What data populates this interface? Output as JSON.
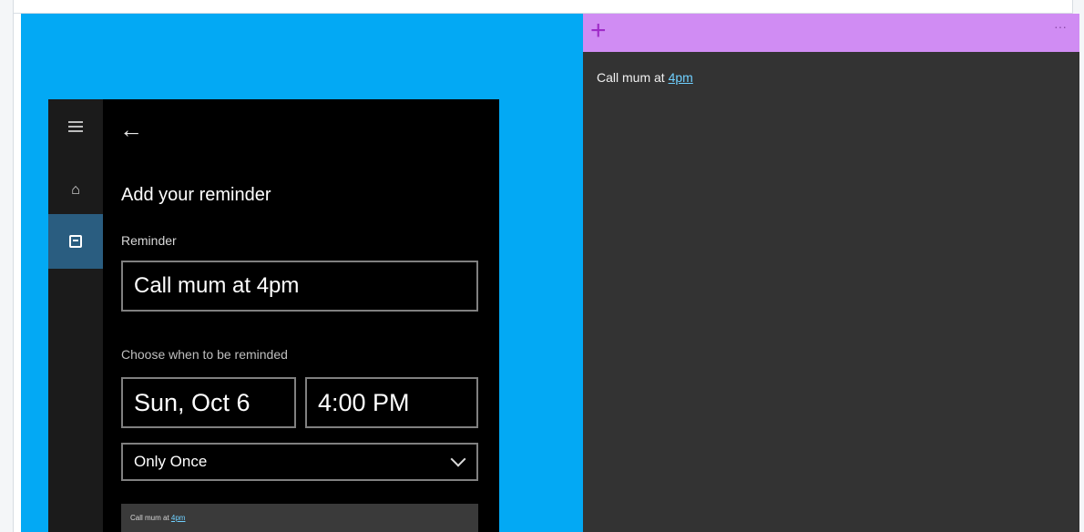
{
  "cortana": {
    "title": "Add your reminder",
    "reminder_label": "Reminder",
    "reminder_value": "Call mum at 4pm",
    "when_label": "Choose when to be reminded",
    "date_value": "Sun, Oct 6",
    "time_value": "4:00 PM",
    "repeat_value": "Only Once",
    "preview_text": "Call mum at ",
    "preview_link": "4pm"
  },
  "sticky_note": {
    "text": "Call mum at ",
    "link": "4pm",
    "header_color": "#d08cf3",
    "body_color": "#333333"
  },
  "colors": {
    "desktop": "#03a9f4",
    "cortana_bg": "#000000",
    "selected_nav": "#2a5d80"
  },
  "icons": {
    "menu": "hamburger-icon",
    "home": "home-icon",
    "reminders": "reminder-icon",
    "back": "back-arrow-icon",
    "add": "plus-icon",
    "more": "more-icon",
    "dropdown": "chevron-down-icon"
  }
}
